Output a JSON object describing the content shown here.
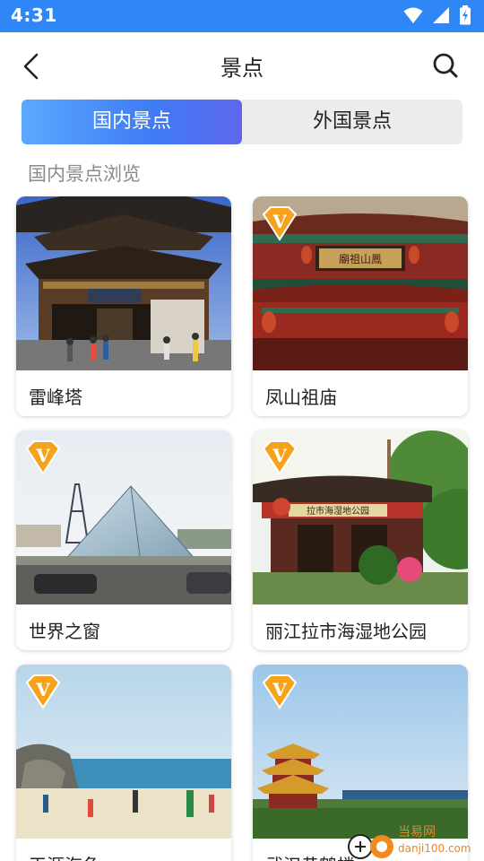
{
  "status_bar": {
    "time": "4:31"
  },
  "header": {
    "title": "景点"
  },
  "tabs": [
    {
      "label": "国内景点",
      "active": true
    },
    {
      "label": "外国景点",
      "active": false
    }
  ],
  "section": {
    "title": "国内景点浏览"
  },
  "attractions": [
    {
      "name": "雷峰塔",
      "vip": false
    },
    {
      "name": "凤山祖庙",
      "vip": true,
      "sign_text": "廟祖山鳳"
    },
    {
      "name": "世界之窗",
      "vip": true
    },
    {
      "name": "丽江拉市海湿地公园",
      "vip": true,
      "sign_text": "拉市海湿地公园"
    },
    {
      "name": "天涯海角",
      "vip": true
    },
    {
      "name": "武汉黄鹤楼",
      "vip": true
    }
  ],
  "vip_badge": {
    "letter": "V"
  },
  "watermark": {
    "cn": "当易网",
    "url": "danji100.com"
  },
  "colors": {
    "accent": "#3f7bf4",
    "status_bar": "#2f86f6",
    "vip": "#f6a21b"
  }
}
